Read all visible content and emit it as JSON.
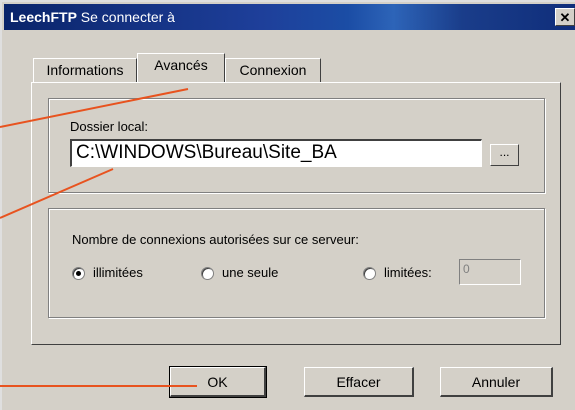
{
  "window": {
    "title_app": "LeechFTP",
    "title_text": "Se connecter à",
    "close_glyph": "✕"
  },
  "tabs": [
    {
      "label": "Informations",
      "active": false
    },
    {
      "label": "Avancés",
      "active": true
    },
    {
      "label": "Connexion",
      "active": false
    }
  ],
  "local_folder": {
    "label": "Dossier local:",
    "value": "C:\\WINDOWS\\Bureau\\Site_BA",
    "browse_label": "..."
  },
  "connections": {
    "label": "Nombre de connexions autorisées sur ce serveur:",
    "options": [
      {
        "label": "illimitées",
        "checked": true
      },
      {
        "label": "une seule",
        "checked": false
      },
      {
        "label": "limitées:",
        "checked": false
      }
    ],
    "limit_value": "0"
  },
  "buttons": {
    "ok": "OK",
    "clear": "Effacer",
    "cancel": "Annuler"
  },
  "colors": {
    "callout_line": "#e8531f",
    "dialog_face": "#d4d0c8"
  }
}
